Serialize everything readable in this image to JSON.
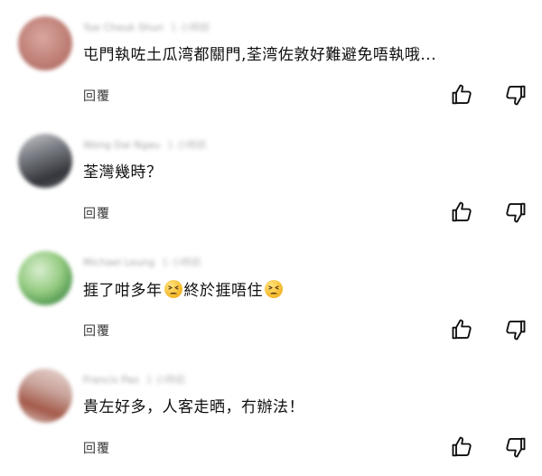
{
  "comments": [
    {
      "author": "Yue Cheuk Shun",
      "time": "1 小時前",
      "text": "屯門執咗土瓜湾都關門,荃湾佐敦好難避免唔執哦...",
      "reply_label": "回覆",
      "avatar_colors": [
        "#c98f86",
        "#b8766d"
      ]
    },
    {
      "author": "Wong Dai Ngau",
      "time": "1 小時前",
      "text": "荃灣幾時？",
      "reply_label": "回覆",
      "avatar_colors": [
        "#8a8d93",
        "#3c3f45"
      ]
    },
    {
      "author": "Michael Leung",
      "time": "1 小時前",
      "text_parts": [
        "捱了咁多年",
        "終於捱唔住"
      ],
      "emoji": "tired-face-emoji",
      "reply_label": "回覆",
      "avatar_colors": [
        "#a7d48d",
        "#3f8a44"
      ]
    },
    {
      "author": "Francis Pao",
      "time": "1 小時前",
      "text": "貴左好多，人客走晒，冇辦法！",
      "reply_label": "回覆",
      "avatar_colors": [
        "#d9b8b0",
        "#9b5848"
      ]
    }
  ],
  "icons": {
    "like": "thumbs-up-icon",
    "dislike": "thumbs-down-icon"
  },
  "colors": {
    "text": "#0f0f0f",
    "meta": "#7a7a7a",
    "reply": "#3a3a3a"
  }
}
